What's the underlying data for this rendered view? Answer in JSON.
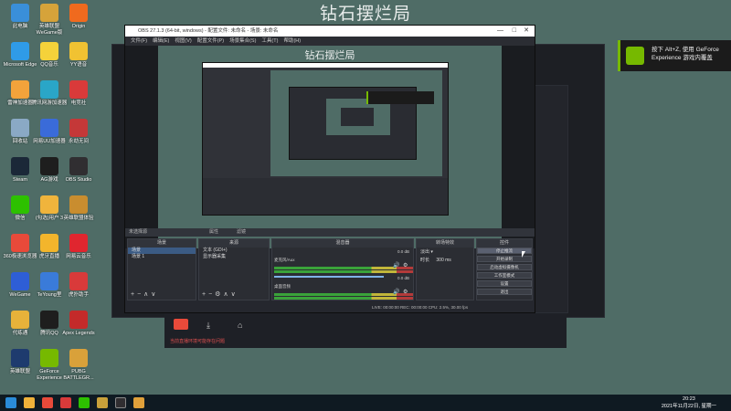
{
  "desktop": {
    "title": "钻石摆烂局",
    "icons": [
      {
        "label": "此电脑",
        "color": "#3a8fd9"
      },
      {
        "label": "英雄联盟 WeGame版",
        "color": "#d6a33a"
      },
      {
        "label": "Origin",
        "color": "#f06a1e"
      },
      {
        "label": "Microsoft Edge",
        "color": "#2f9be8"
      },
      {
        "label": "QQ音乐",
        "color": "#f5d23a"
      },
      {
        "label": "YY语音",
        "color": "#f1c232"
      },
      {
        "label": "雷神加速器",
        "color": "#f2a33b"
      },
      {
        "label": "腾讯网游加速器",
        "color": "#2aa6c7"
      },
      {
        "label": "电竞社",
        "color": "#d93a3a"
      },
      {
        "label": "回收站",
        "color": "#8aa9c5"
      },
      {
        "label": "网易UU加速器",
        "color": "#3a6bd9"
      },
      {
        "label": "永劫无间",
        "color": "#c43838"
      },
      {
        "label": "Steam",
        "color": "#1b2838"
      },
      {
        "label": "AG游戏",
        "color": "#1e1e1e"
      },
      {
        "label": "OBS Studio",
        "color": "#302e31"
      },
      {
        "label": "微信",
        "color": "#2dc100"
      },
      {
        "label": "(勾选)用户 3",
        "color": "#f0b43c"
      },
      {
        "label": "英雄联盟体验",
        "color": "#c98d2f"
      },
      {
        "label": "360极速浏览器",
        "color": "#e84a3a"
      },
      {
        "label": "虎牙直播",
        "color": "#f3b52c"
      },
      {
        "label": "网易云音乐",
        "color": "#e0262f"
      },
      {
        "label": "WeGame",
        "color": "#2e5ed6"
      },
      {
        "label": "TeYoung里",
        "color": "#3a7bd9"
      },
      {
        "label": "虎扑助手",
        "color": "#d93a3a"
      },
      {
        "label": "代练通",
        "color": "#e7b23a"
      },
      {
        "label": "腾讯QQ",
        "color": "#1e1e1e"
      },
      {
        "label": "Apex Legends",
        "color": "#c42a2a"
      },
      {
        "label": "英雄联盟",
        "color": "#1e3b6e"
      },
      {
        "label": "GeForce Experience",
        "color": "#76b900"
      },
      {
        "label": "PUBG BATTLEGR...",
        "color": "#d9a13a"
      }
    ]
  },
  "nvidia_toast": {
    "text": "按下 Alt+Z, 使用 GeForce Experience 游戏内覆盖"
  },
  "obs": {
    "title": "OBS 27.1.3 (64-bit, windows) - 配置文件: 未命名 - 场景: 未命名",
    "menu": [
      "文件(F)",
      "编辑(E)",
      "视图(V)",
      "配置文件(P)",
      "场景集合(S)",
      "工具(T)",
      "帮助(H)"
    ],
    "preview_title": "钻石摆烂局",
    "scene_bar": "未选择源",
    "scene_bar_buttons": [
      "属性",
      "滤镜"
    ],
    "docks": {
      "scenes": {
        "header": "场景",
        "items": [
          "场景",
          "场景 1"
        ]
      },
      "sources": {
        "header": "来源",
        "items": [
          "文本 (GDI+)",
          "显示器采集"
        ]
      },
      "mixer": {
        "header": "混音器",
        "channels": [
          {
            "name": "麦克风/Aux",
            "db": "0.0 dB"
          },
          {
            "name": "桌面音频",
            "db": "0.0 dB"
          }
        ]
      },
      "transitions": {
        "header": "转场特效",
        "type": "淡出",
        "duration_label": "时长",
        "duration": "300 ms"
      },
      "controls": {
        "header": "控件",
        "buttons": [
          "停止推流",
          "开始录制",
          "启动虚拟摄像机",
          "工作室模式",
          "设置",
          "退出"
        ]
      }
    },
    "status": "LIVE: 00:00:00   REC: 00:00:00   CPU: 2.5%, 30.00 fps"
  },
  "app_bottom": {
    "warning": "当前直播环境可能存在问题"
  },
  "taskbar": {
    "time": "20:23",
    "date": "2021年11月22日, 星期一"
  }
}
